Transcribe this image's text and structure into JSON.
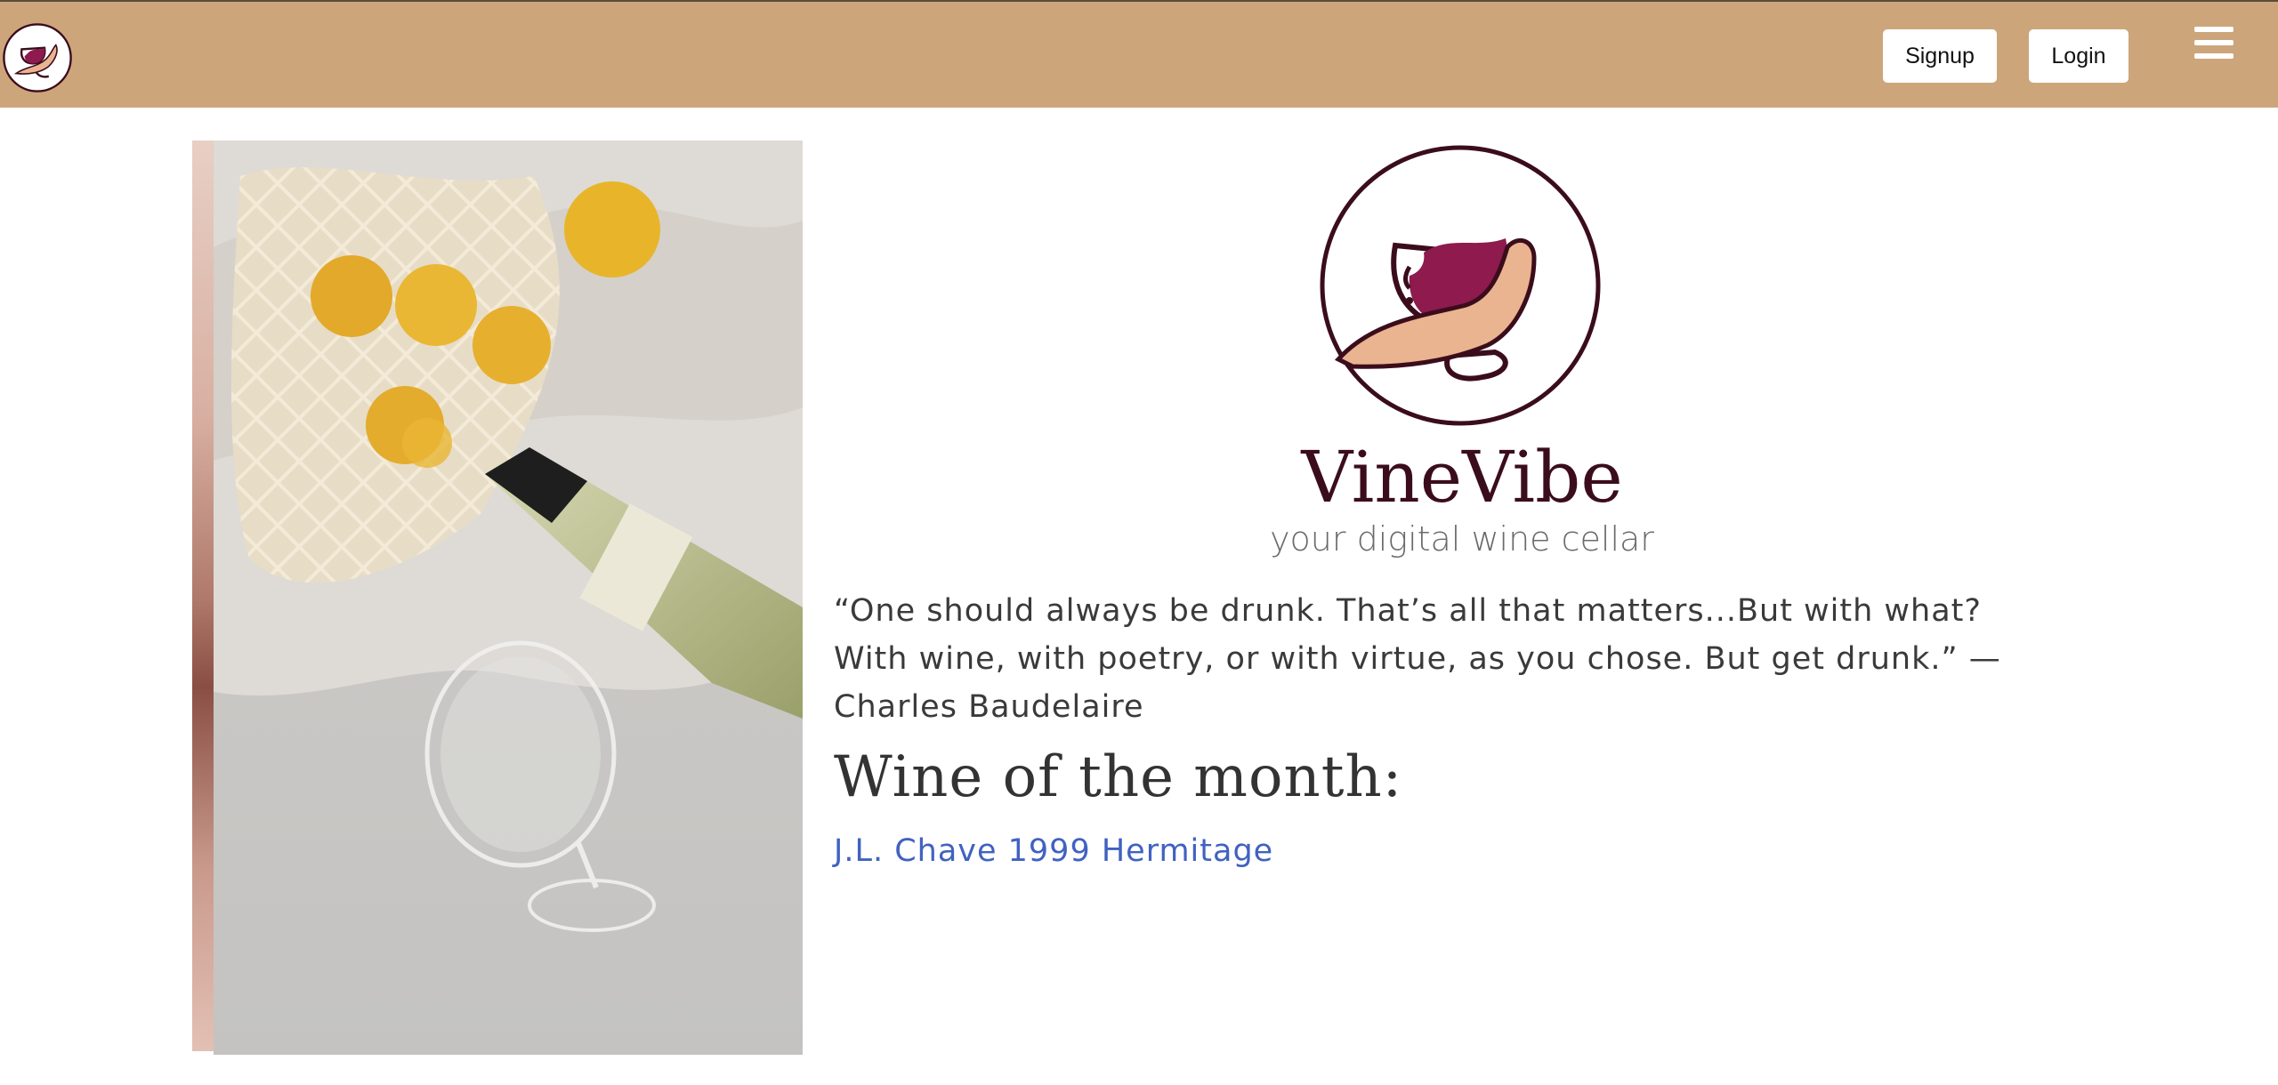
{
  "nav": {
    "signup_label": "Signup",
    "login_label": "Login",
    "menu_icon": "hamburger-menu-icon",
    "logo_icon": "wine-glass-hand-logo"
  },
  "hero": {
    "brand_name": "VineVibe",
    "tagline": "your digital wine cellar",
    "quote": "“One should always be drunk. That’s all that matters...But with what? With wine, with poetry, or with virtue, as you chose. But get drunk.” — Charles Baudelaire",
    "wine_of_month_heading": "Wine of the month:",
    "wine_of_month_link": "J.L. Chave 1999 Hermitage"
  },
  "colors": {
    "navbar": "#cda57b",
    "brand": "#3b0d1c",
    "wine": "#8e1a4e",
    "hand": "#e9b48f",
    "link": "#4062c0"
  },
  "carousel": {
    "image": "photo: lemons in mesh bag, white wine bottle and glass on linen"
  }
}
